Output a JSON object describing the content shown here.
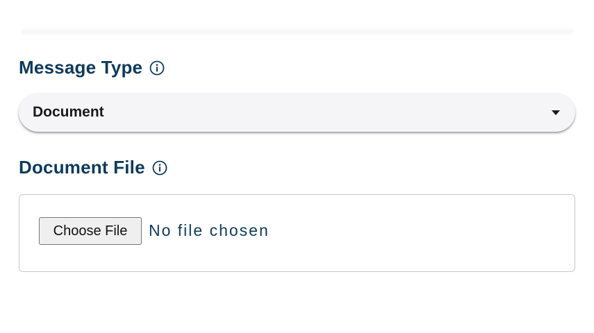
{
  "message_type": {
    "label": "Message Type",
    "info_icon": "info-icon",
    "selected_value": "Document"
  },
  "document_file": {
    "label": "Document File",
    "info_icon": "info-icon",
    "button_label": "Choose File",
    "status_text": "No file chosen"
  },
  "colors": {
    "label_text": "#0e3a5b",
    "select_background": "#f5f5f7",
    "file_border": "#c8c8cc"
  }
}
